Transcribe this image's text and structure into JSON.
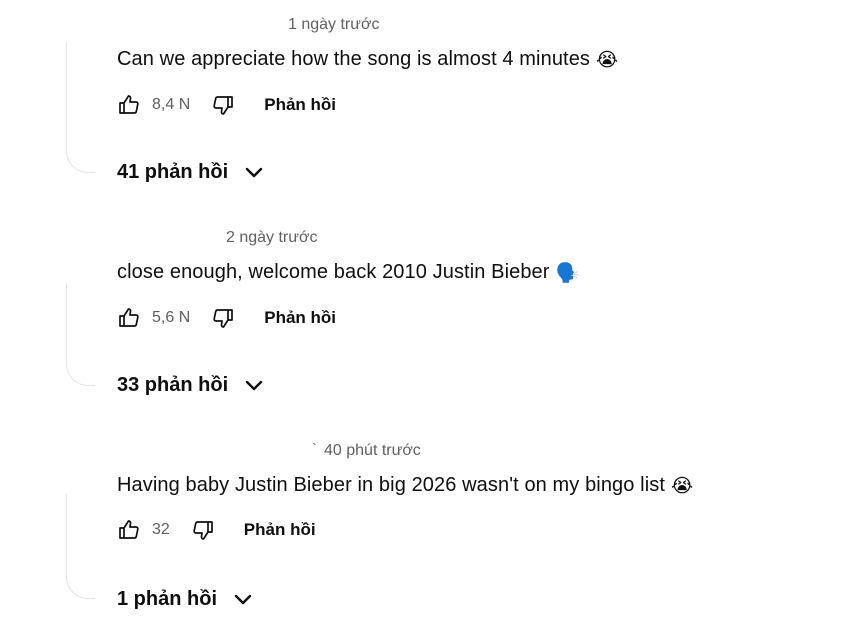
{
  "comments": [
    {
      "time": "1 ngày trước",
      "text": "Can we appreciate how the song is almost 4 minutes",
      "emoji": "😭",
      "likes": "8,4 N",
      "reply_label": "Phản hồi",
      "replies_label": "41 phản hồi"
    },
    {
      "time": "2 ngày trước",
      "text": "close enough, welcome back 2010 Justin Bieber",
      "emoji": "🗣️",
      "likes": "5,6 N",
      "reply_label": "Phản hồi",
      "replies_label": "33 phản hồi"
    },
    {
      "time": "40 phút trước",
      "time_prefix": "`",
      "text": "Having baby Justin Bieber in big 2026 wasn't on my bingo list",
      "emoji": "😭",
      "likes": "32",
      "reply_label": "Phản hồi",
      "replies_label": "1 phản hồi"
    }
  ],
  "icons": {
    "like": "thumbs-up-icon",
    "dislike": "thumbs-down-icon",
    "expand": "chevron-down-icon"
  },
  "colors": {
    "text": "#0f0f0f",
    "secondary": "#606060",
    "thread_line": "#e5e5e5"
  }
}
